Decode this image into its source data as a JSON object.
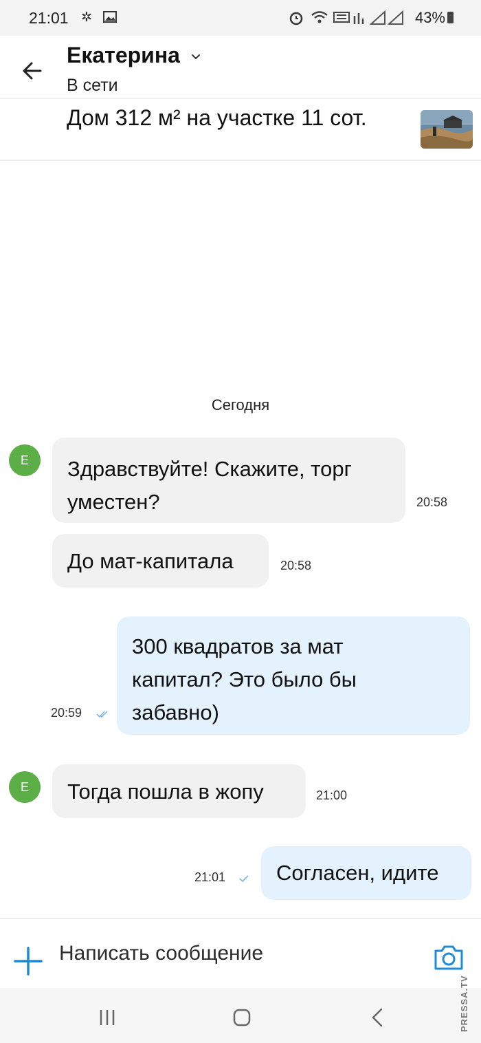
{
  "status_bar": {
    "time": "21:01",
    "battery": "43%",
    "icons": [
      "gear-icon",
      "image-icon",
      "alarm-icon",
      "wifi-icon",
      "volte-icon",
      "signal-icon",
      "battery-icon"
    ]
  },
  "header": {
    "contact_name": "Екатерина",
    "contact_status": "В сети",
    "listing_title": "Дом 312 м² на участке 11 сот."
  },
  "chat": {
    "date_separator": "Сегодня",
    "messages": [
      {
        "direction": "in",
        "avatar_letter": "Е",
        "text": "Здравствуйте! Скажите, торг уместен?",
        "time": "20:58"
      },
      {
        "direction": "in",
        "text": "До мат-капитала",
        "time": "20:58"
      },
      {
        "direction": "out",
        "text": "300 квадратов за мат капитал? Это было бы забавно)",
        "time": "20:59",
        "read": true
      },
      {
        "direction": "in",
        "avatar_letter": "Е",
        "text": "Тогда пошла в жопу",
        "time": "21:00"
      },
      {
        "direction": "out",
        "text": "Согласен, идите",
        "time": "21:01",
        "read": false
      }
    ]
  },
  "composer": {
    "placeholder": "Написать сообщение"
  },
  "watermark": "PRESSA.TV",
  "colors": {
    "accent": "#1d8bd6",
    "avatar": "#5cae46",
    "incoming_bubble": "#f1f1f1",
    "outgoing_bubble": "#e3f2fc"
  }
}
